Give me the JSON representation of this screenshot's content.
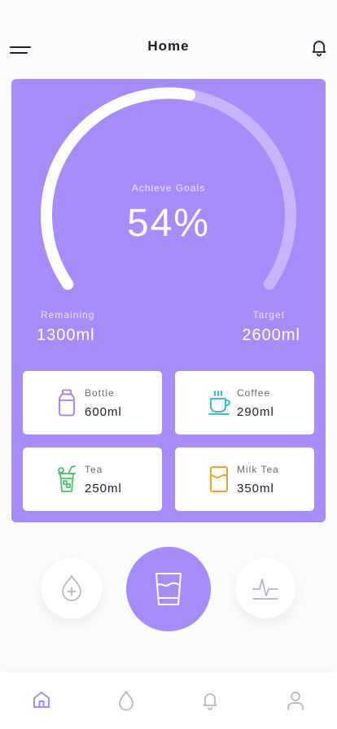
{
  "header": {
    "title": "Home",
    "menu_icon": "hamburger-menu-icon",
    "bell_icon": "bell-icon"
  },
  "progress": {
    "caption": "Achieve Goals",
    "percent_label": "54%",
    "percent": 54
  },
  "stats": {
    "remaining_label": "Remaining",
    "remaining_value": "1300ml",
    "target_label": "Target",
    "target_value": "2600ml"
  },
  "drinks": [
    {
      "name": "Bottle",
      "amount": "600ml",
      "icon": "bottle-icon",
      "color": "#9d7ff0"
    },
    {
      "name": "Coffee",
      "amount": "290ml",
      "icon": "coffee-cup-icon",
      "color": "#22b7c9"
    },
    {
      "name": "Tea",
      "amount": "250ml",
      "icon": "iced-tea-icon",
      "color": "#4cc26b"
    },
    {
      "name": "Milk Tea",
      "amount": "350ml",
      "icon": "milk-tea-icon",
      "color": "#f0a028"
    }
  ],
  "actions": [
    {
      "icon": "water-drop-plus-icon"
    },
    {
      "icon": "glass-icon"
    },
    {
      "icon": "activity-chart-icon"
    }
  ],
  "tabs": [
    {
      "icon": "home-icon",
      "active": true
    },
    {
      "icon": "drop-icon",
      "active": false
    },
    {
      "icon": "bell-icon",
      "active": false
    },
    {
      "icon": "user-icon",
      "active": false
    }
  ],
  "colors": {
    "accent": "#a68bfa",
    "gauge_track": "#c6b4fc",
    "gauge_fill": "#ffffff",
    "inactive_icon": "#b8b8c4"
  }
}
